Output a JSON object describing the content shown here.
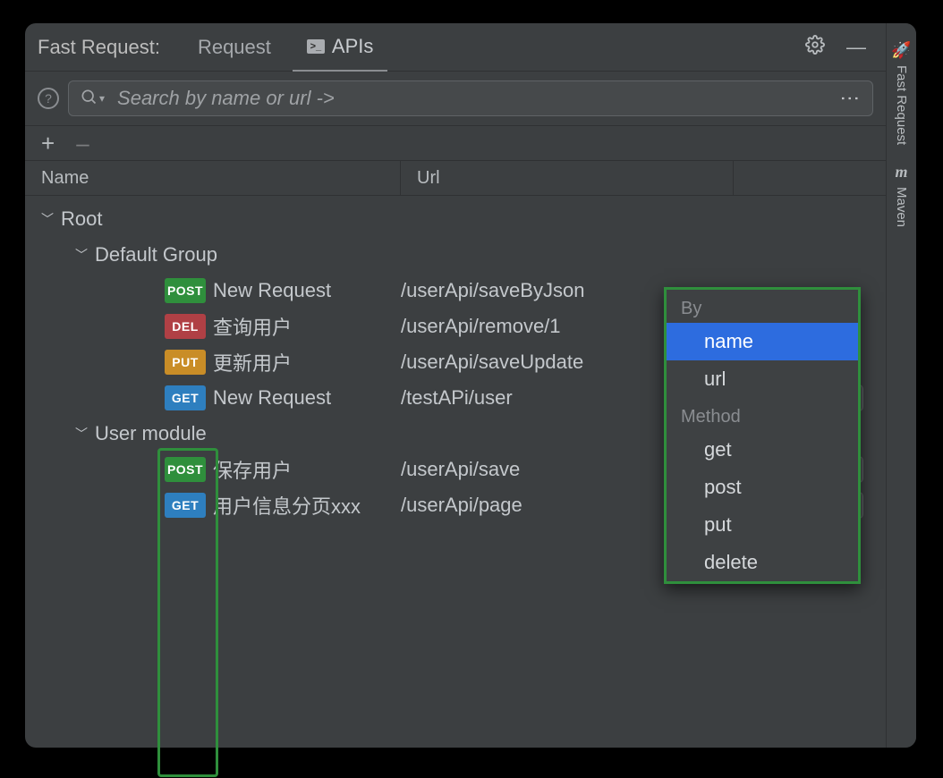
{
  "header": {
    "app_title": "Fast Request:",
    "tabs": [
      {
        "label": "Request",
        "active": false
      },
      {
        "label": "APIs",
        "active": true
      }
    ]
  },
  "search": {
    "placeholder": "Search by name or url ->"
  },
  "columns": {
    "col_name": "Name",
    "col_url": "Url"
  },
  "tree": {
    "root_label": "Root",
    "groups": [
      {
        "label": "Default Group",
        "items": [
          {
            "method": "POST",
            "cls": "m-post",
            "name": "New Request",
            "url": "/userApi/saveByJson",
            "nav": false
          },
          {
            "method": "DEL",
            "cls": "m-del",
            "name": "查询用户",
            "url": "/userApi/remove/1",
            "nav": false
          },
          {
            "method": "PUT",
            "cls": "m-put",
            "name": "更新用户",
            "url": "/userApi/saveUpdate",
            "nav": false
          },
          {
            "method": "GET",
            "cls": "m-get",
            "name": "New Request",
            "url": "/testAPi/user",
            "nav": true
          }
        ]
      },
      {
        "label": "User module",
        "items": [
          {
            "method": "POST",
            "cls": "m-post",
            "name": "保存用户",
            "url": "/userApi/save",
            "nav": true
          },
          {
            "method": "GET",
            "cls": "m-get",
            "name": "用户信息分页xxx",
            "url": "/userApi/page",
            "nav": true
          }
        ]
      }
    ]
  },
  "popup": {
    "section_by": "By",
    "by_items": [
      "name",
      "url"
    ],
    "by_selected": "name",
    "section_method": "Method",
    "method_items": [
      "get",
      "post",
      "put",
      "delete"
    ]
  },
  "right_sidebar": {
    "tab1": "Fast Request",
    "tab2": "Maven"
  }
}
